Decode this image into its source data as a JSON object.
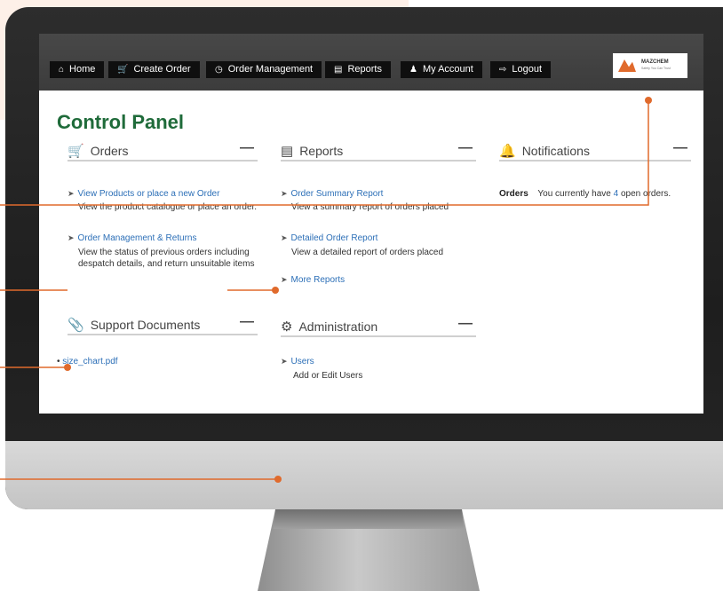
{
  "nav": {
    "home": "Home",
    "create_order": "Create Order",
    "order_management": "Order Management",
    "reports": "Reports",
    "my_account": "My Account",
    "logout": "Logout"
  },
  "logo": {
    "name": "MAZCHEM",
    "tagline": "Safety You Can Trust"
  },
  "page_title": "Control Panel",
  "panels": {
    "orders": {
      "title": "Orders",
      "links": [
        {
          "label": "View Products or place a new Order",
          "desc": "View the product catalogue or place an order."
        },
        {
          "label": "Order Management & Returns",
          "desc": "View the status of previous orders including despatch details, and return unsuitable items"
        }
      ]
    },
    "reports": {
      "title": "Reports",
      "links": [
        {
          "label": "Order Summary Report",
          "desc": "View a summary report of orders placed"
        },
        {
          "label": "Detailed Order Report",
          "desc": "View a detailed report of orders placed"
        },
        {
          "label": "More Reports"
        }
      ]
    },
    "notifications": {
      "title": "Notifications",
      "label": "Orders",
      "text_before": "You currently have",
      "count": "4",
      "text_after": "open orders."
    },
    "support": {
      "title": "Support Documents",
      "file": "size_chart.pdf"
    },
    "administration": {
      "title": "Administration",
      "link": "Users",
      "desc": "Add or Edit Users"
    }
  },
  "colors": {
    "accent": "#e06a2c",
    "title_green": "#1f6b3a",
    "link_blue": "#2c6fb7",
    "nav_bg": "#3c3c3c"
  }
}
